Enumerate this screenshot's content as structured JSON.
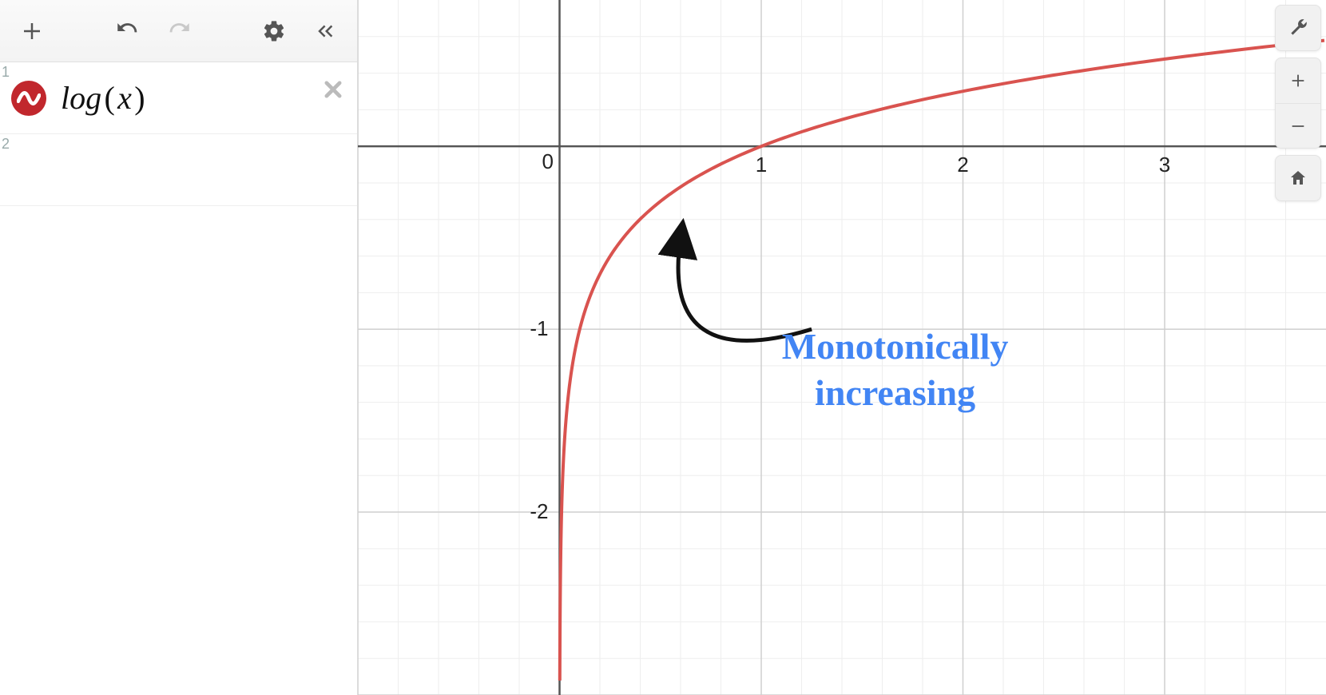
{
  "toolbar": {
    "add": "+",
    "undo": "undo",
    "redo": "redo",
    "settings": "settings",
    "collapse": "collapse"
  },
  "expressions": [
    {
      "index": "1",
      "formula_html": "log&#8202;<span class='paren'>(</span>&#8202;x&#8202;<span class='paren'>)</span>",
      "color": "#c1272d"
    },
    {
      "index": "2",
      "formula_html": ""
    }
  ],
  "graph": {
    "origin_label": "0",
    "x_ticks": [
      1,
      2,
      3
    ],
    "y_ticks": [
      -1,
      -2
    ]
  },
  "annotation": {
    "line1": "Monotonically",
    "line2": "increasing"
  },
  "right_controls": {
    "wrench": "settings-wrench",
    "zoom_in": "+",
    "zoom_out": "−",
    "home": "home"
  },
  "chart_data": {
    "type": "line",
    "title": "",
    "xlabel": "",
    "ylabel": "",
    "xlim": [
      -1.0,
      3.8
    ],
    "ylim": [
      -3.0,
      0.8
    ],
    "grid": true,
    "series": [
      {
        "name": "log(x)",
        "function": "y = log10(x)",
        "color": "#d9534f",
        "sample_points": {
          "x": [
            0.001,
            0.005,
            0.01,
            0.02,
            0.05,
            0.1,
            0.2,
            0.3,
            0.5,
            0.7,
            1.0,
            1.5,
            2.0,
            2.5,
            3.0,
            3.5,
            3.8
          ],
          "y": [
            -3.0,
            -2.301,
            -2.0,
            -1.699,
            -1.301,
            -1.0,
            -0.699,
            -0.523,
            -0.301,
            -0.155,
            0.0,
            0.176,
            0.301,
            0.398,
            0.477,
            0.544,
            0.58
          ]
        }
      }
    ],
    "annotations": [
      {
        "text": "Monotonically increasing",
        "xy": [
          0.6,
          -0.5
        ],
        "xytext": [
          1.3,
          -1.1
        ],
        "arrow": true
      }
    ]
  }
}
